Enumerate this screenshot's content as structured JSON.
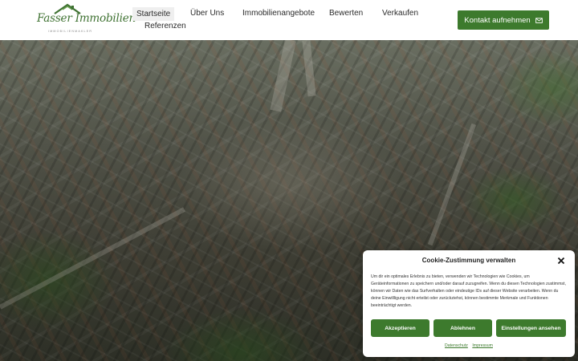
{
  "brand": {
    "logo_text": "Fasser Immobilien",
    "logo_subtext": "IMMOBILIENMAKLER",
    "accent": "#3d7a2d"
  },
  "nav": {
    "items": [
      {
        "label": "Startseite",
        "active": true
      },
      {
        "label": "Über Uns"
      },
      {
        "label": "Immobilienangebote"
      },
      {
        "label": "Bewerten"
      },
      {
        "label": "Verkaufen"
      },
      {
        "label": "Referenzen"
      }
    ]
  },
  "header": {
    "cta_label": "Kontakt aufnehmen",
    "cta_icon": "envelope-icon"
  },
  "hero": {
    "image": "aerial-city-photo"
  },
  "cookie": {
    "title": "Cookie-Zustimmung verwalten",
    "close_icon": "close-icon",
    "text": "Um dir ein optimales Erlebnis zu bieten, verwenden wir Technologien wie Cookies, um Geräteinformationen zu speichern und/oder darauf zuzugreifen. Wenn du diesen Technologien zustimmst, können wir Daten wie das Surfverhalten oder eindeutige IDs auf dieser Website verarbeiten. Wenn du deine Einwillligung nicht erteilst oder zurückziehst, können bestimmte Merkmale und Funktionen beeinträchtigt werden.",
    "accept_label": "Akzeptieren",
    "decline_label": "Ablehnen",
    "settings_label": "Einstellungen ansehen",
    "links": {
      "privacy": "Datenschutz",
      "imprint": "Impressum"
    }
  }
}
